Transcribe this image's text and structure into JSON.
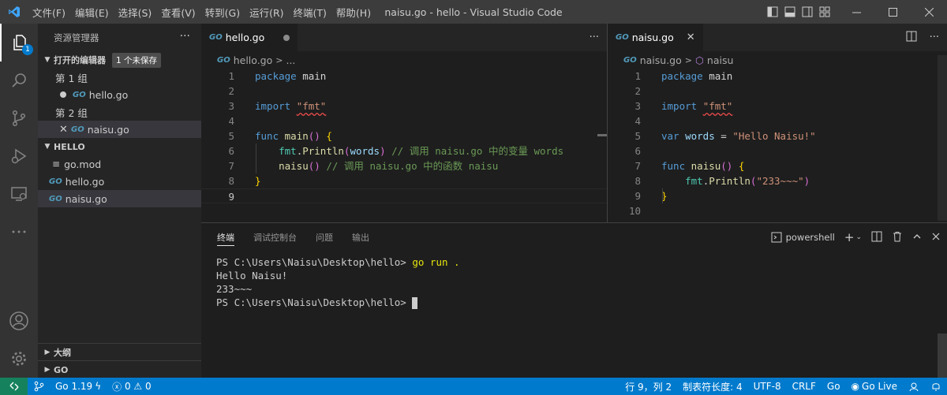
{
  "titlebar": {
    "menu": [
      "文件(F)",
      "编辑(E)",
      "选择(S)",
      "查看(V)",
      "转到(G)",
      "运行(R)",
      "终端(T)",
      "帮助(H)"
    ],
    "title": "naisu.go - hello - Visual Studio Code"
  },
  "activity": {
    "explorer_badge": "1"
  },
  "sidebar": {
    "title": "资源管理器",
    "more": "···",
    "open_editors": {
      "label": "打开的编辑器",
      "badge": "1 个未保存",
      "group1": "第 1 组",
      "group1_file": "hello.go",
      "group2": "第 2 组",
      "group2_file": "naisu.go"
    },
    "folder": {
      "label": "HELLO",
      "files": [
        "go.mod",
        "hello.go",
        "naisu.go"
      ]
    },
    "outline": "大纲",
    "go": "GO"
  },
  "editor_left": {
    "tab": "hello.go",
    "breadcrumb_file": "hello.go",
    "breadcrumb_rest": "...",
    "line_numbers": [
      "1",
      "2",
      "3",
      "4",
      "5",
      "6",
      "7",
      "8",
      "9"
    ]
  },
  "editor_right": {
    "tab": "naisu.go",
    "breadcrumb_file": "naisu.go",
    "breadcrumb_symbol": "naisu",
    "line_numbers": [
      "1",
      "2",
      "3",
      "4",
      "5",
      "6",
      "7",
      "8",
      "9",
      "10"
    ]
  },
  "panel": {
    "tabs": [
      "终端",
      "调试控制台",
      "问题",
      "输出"
    ],
    "shell": "powershell",
    "terminal_lines": [
      "PS C:\\Users\\Naisu\\Desktop\\hello> ",
      "Hello Naisu!",
      "233~~~",
      "PS C:\\Users\\Naisu\\Desktop\\hello> "
    ],
    "command": "go run ."
  },
  "statusbar": {
    "go_version": "Go 1.19",
    "errors": "0",
    "warnings": "0",
    "position": "行 9，列 2",
    "tab_size": "制表符长度: 4",
    "encoding": "UTF-8",
    "eol": "CRLF",
    "language": "Go",
    "live": "Go Live"
  },
  "colors": {
    "accent": "#007acc",
    "remote": "#16825d",
    "go_icon": "#519aba"
  }
}
